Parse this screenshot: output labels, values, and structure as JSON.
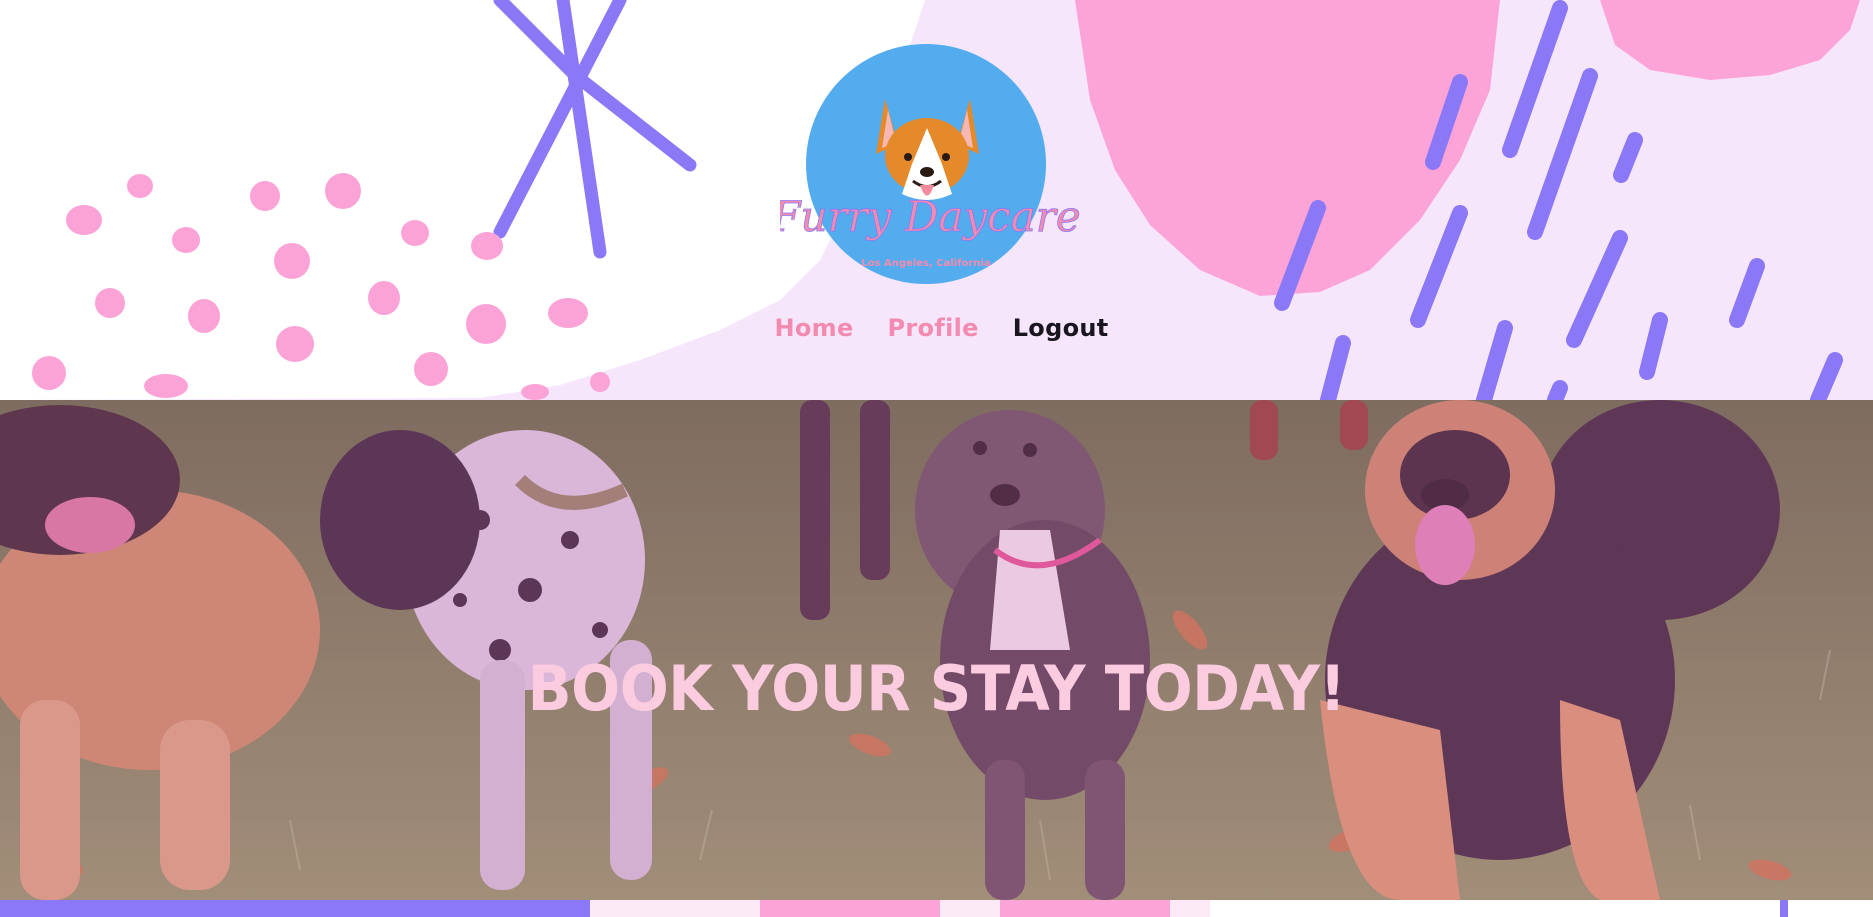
{
  "brand": {
    "name": "Furry Daycare",
    "location": "Los Angeles, California",
    "logo_icon": "corgi-icon"
  },
  "nav": {
    "items": [
      {
        "label": "Home",
        "active": false
      },
      {
        "label": "Profile",
        "active": false
      },
      {
        "label": "Logout",
        "active": true
      }
    ]
  },
  "hero": {
    "title": "BOOK YOUR STAY TODAY!",
    "image": "dogs-in-grass-photo"
  },
  "colors": {
    "pink": "#f38bb0",
    "purple": "#8b78f6",
    "lavender": "#f5e8fc",
    "logo_blue": "#53aced",
    "hero_text": "#fbcbe0",
    "nav_active": "#1a1620"
  }
}
